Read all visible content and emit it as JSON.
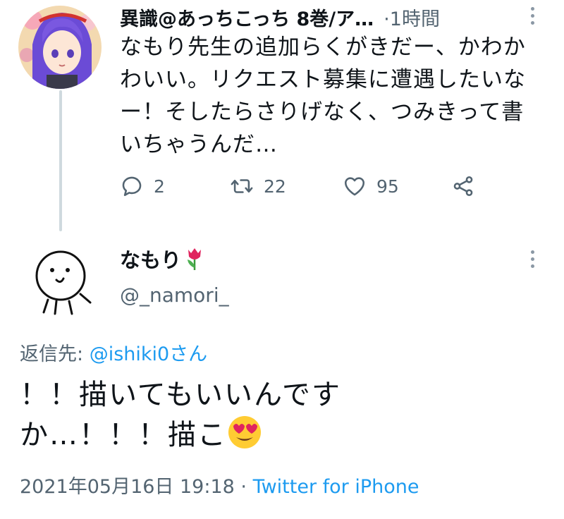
{
  "parent_tweet": {
    "display_name": "異識@あっちこっち 8巻/ア…",
    "time_separator": "·",
    "time": "1時間",
    "text_lines": [
      "なもり先生の追加らくがきだー、かわか",
      "わいい。リクエスト募集に遭遇したいな",
      "ー！そしたらさりげなく、つみきって書",
      "いちゃうんだ…"
    ],
    "actions": {
      "reply_count": "2",
      "retweet_count": "22",
      "like_count": "95"
    }
  },
  "reply_tweet": {
    "display_name": "なもり",
    "name_emoji": "tulip-emoji",
    "handle": "@_namori_",
    "reply_to_label": "返信先: ",
    "reply_to_handle": "@ishiki0さん",
    "body_line1": "！！描いてもいいんです",
    "body_line2": "か…！！！描こ",
    "body_emoji": "heart-eyes-emoji",
    "date": "2021年05月16日 19:18",
    "meta_separator": " · ",
    "source": "Twitter for iPhone"
  },
  "colors": {
    "link": "#1d9bf0",
    "secondary_text": "#536471",
    "primary_text": "#0f1419",
    "thread_line": "#cfd9de"
  }
}
